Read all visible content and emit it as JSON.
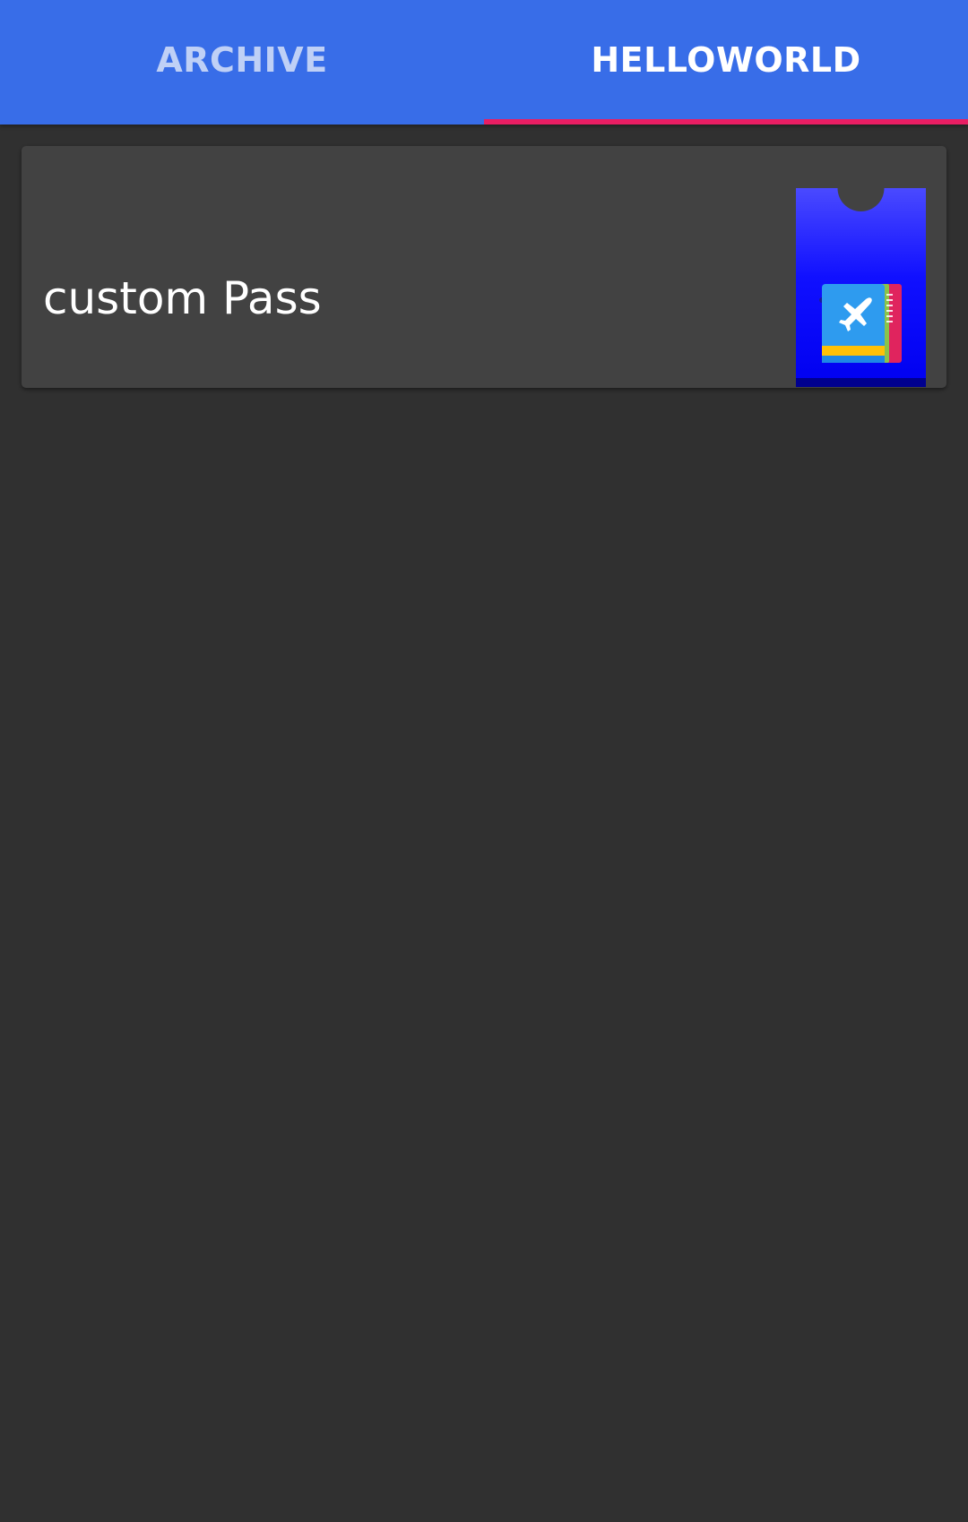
{
  "tabs": [
    {
      "label": "ARCHIVE",
      "active": false
    },
    {
      "label": "HELLOWORLD",
      "active": true
    }
  ],
  "passes": [
    {
      "title": "custom Pass",
      "icon": "airplane-ticket-icon"
    }
  ],
  "colors": {
    "tabbar": "#386DE8",
    "indicator": "#E91E63",
    "background": "#303030",
    "card": "#424242",
    "pass_background": "#0000FF"
  }
}
